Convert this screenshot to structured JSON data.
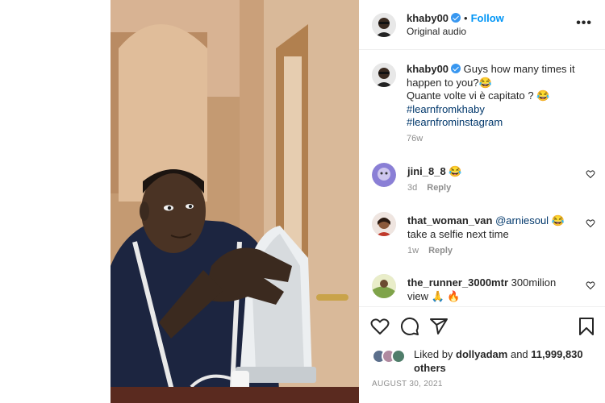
{
  "header": {
    "username": "khaby00",
    "separator": "•",
    "follow_label": "Follow",
    "subtitle": "Original audio",
    "more_label": "•••"
  },
  "caption": {
    "username": "khaby00",
    "line1": "Guys how many times it happen to you?😂",
    "line2": "Quante volte vi è capitato ? 😂",
    "hashtags": [
      "#learnfromkhaby",
      "#learnfrominstagram"
    ],
    "time": "76w"
  },
  "comments": [
    {
      "username": "jini_8_8",
      "text": "😂",
      "time": "3d",
      "reply_label": "Reply"
    },
    {
      "username": "that_woman_van",
      "mention": "@arniesoul",
      "text": "😂 take a selfie next time",
      "time": "1w",
      "reply_label": "Reply"
    },
    {
      "username": "the_runner_3000mtr",
      "text": "300milion view 🙏 🔥"
    }
  ],
  "likes": {
    "prefix": "Liked by",
    "user": "dollyadam",
    "joiner": "and",
    "others": "11,999,830 others"
  },
  "post_date": "AUGUST 30, 2021",
  "icons": [
    "heart-icon",
    "comment-icon",
    "share-icon",
    "bookmark-icon",
    "verified-icon",
    "more-icon"
  ],
  "colors": {
    "accent": "#0095f6",
    "verified": "#3897f0",
    "hashtag": "#00376b",
    "muted": "#8e8e8e"
  }
}
